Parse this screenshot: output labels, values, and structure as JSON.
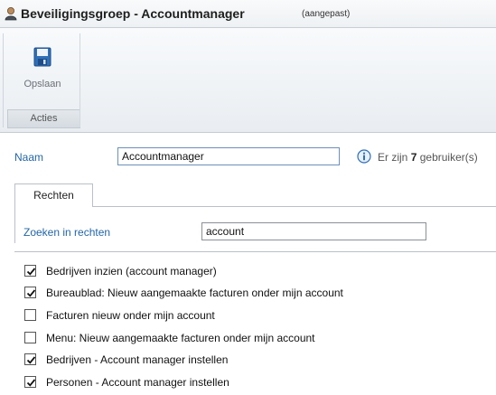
{
  "window": {
    "title": "Beveiligingsgroep - Accountmanager",
    "status": "(aangepast)"
  },
  "ribbon": {
    "save_label": "Opslaan",
    "group_label": "Acties"
  },
  "form": {
    "naam_label": "Naam",
    "naam_value": "Accountmanager",
    "info_prefix": "Er zijn",
    "info_count": "7",
    "info_suffix": "gebruiker(s)",
    "tab_label": "Rechten",
    "zoek_label": "Zoeken in rechten",
    "zoek_value": "account"
  },
  "permissions": [
    {
      "label": "Bedrijven inzien (account manager)",
      "checked": true
    },
    {
      "label": "Bureaublad: Nieuw aangemaakte facturen onder mijn account",
      "checked": true
    },
    {
      "label": "Facturen nieuw onder mijn account",
      "checked": false
    },
    {
      "label": "Menu: Nieuw aangemaakte facturen onder mijn account",
      "checked": false
    },
    {
      "label": "Bedrijven - Account manager instellen",
      "checked": true
    },
    {
      "label": "Personen - Account manager instellen",
      "checked": true
    }
  ]
}
